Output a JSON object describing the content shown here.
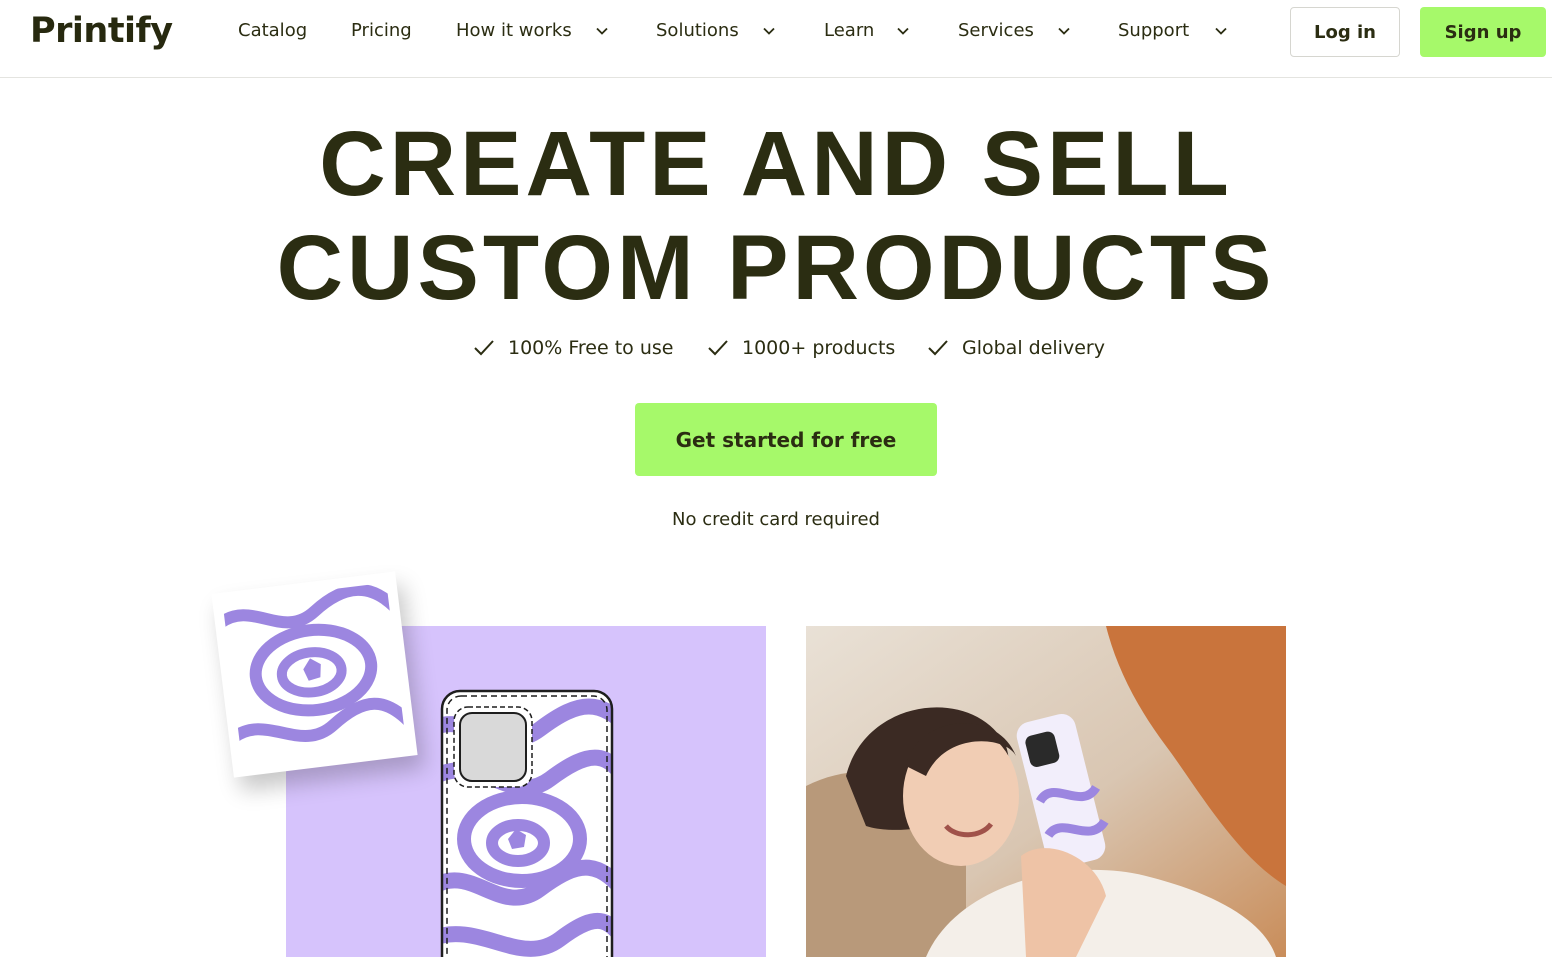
{
  "brand": {
    "logo_text": "Printify"
  },
  "nav": {
    "items": [
      {
        "label": "Catalog",
        "has_dropdown": false
      },
      {
        "label": "Pricing",
        "has_dropdown": false
      },
      {
        "label": "How it works",
        "has_dropdown": true
      },
      {
        "label": "Solutions",
        "has_dropdown": true
      },
      {
        "label": "Learn",
        "has_dropdown": true
      },
      {
        "label": "Services",
        "has_dropdown": true
      },
      {
        "label": "Support",
        "has_dropdown": true
      }
    ],
    "login_label": "Log in",
    "signup_label": "Sign up"
  },
  "hero": {
    "title_line1": "CREATE AND SELL",
    "title_line2": "CUSTOM PRODUCTS",
    "features": [
      "100% Free to use",
      "1000+ products",
      "Global delivery"
    ],
    "cta_label": "Get started for free",
    "note": "No credit card required"
  },
  "images": {
    "left": "phone-case-design-mockup",
    "right": "woman-holding-phone-with-custom-case"
  },
  "colors": {
    "accent_green": "#a6f96a",
    "text_dark": "#2b2d12",
    "lavender": "#d6c3fc",
    "pattern_purple": "#9c86e0"
  }
}
